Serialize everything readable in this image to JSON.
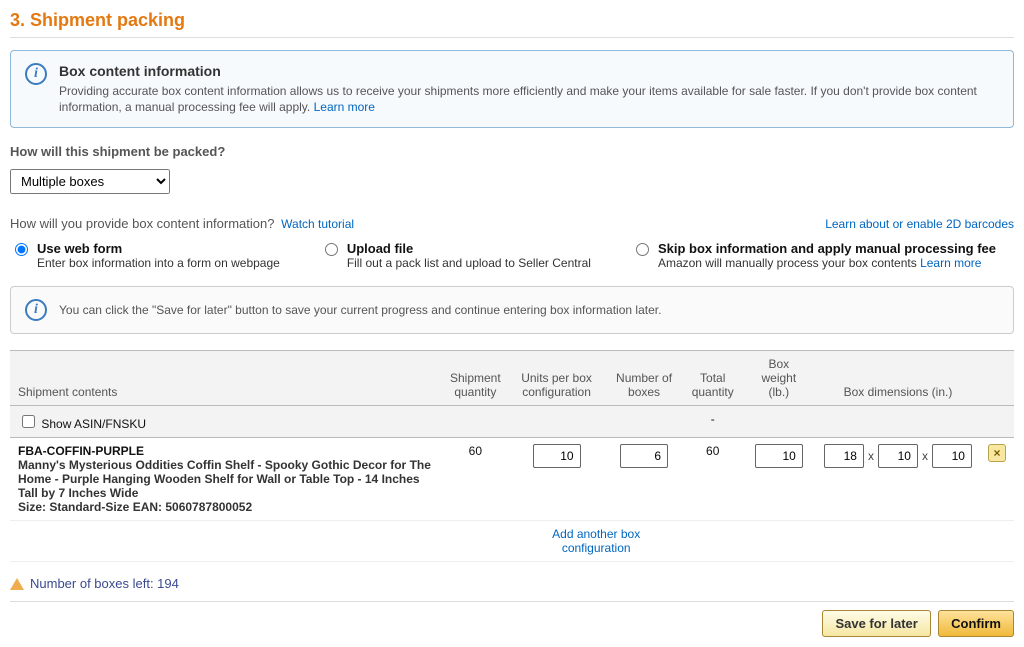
{
  "section_title": "3. Shipment packing",
  "info_alert": {
    "title": "Box content information",
    "body": "Providing accurate box content information allows us to receive your shipments more efficiently and make your items available for sale faster. If you don't provide box content information, a manual processing fee will apply.",
    "learn_more": "Learn more"
  },
  "pack_question": "How will this shipment be packed?",
  "pack_select_value": "Multiple boxes",
  "provide_question": "How will you provide box content information?",
  "watch_tutorial": "Watch tutorial",
  "enable_2d": "Learn about or enable 2D barcodes",
  "radios": {
    "web": {
      "label": "Use web form",
      "desc": "Enter box information into a form on webpage"
    },
    "upload": {
      "label": "Upload file",
      "desc": "Fill out a pack list and upload to Seller Central"
    },
    "skip": {
      "label": "Skip box information and apply manual processing fee",
      "desc_prefix": "Amazon will manually process your box contents ",
      "learn_more": "Learn more"
    }
  },
  "save_tip": "You can click the \"Save for later\" button to save your current progress and continue entering box information later.",
  "table": {
    "headers": {
      "contents": "Shipment contents",
      "ship_qty": "Shipment\nquantity",
      "units_per_box": "Units per box\nconfiguration",
      "num_boxes": "Number of\nboxes",
      "total_qty": "Total\nquantity",
      "box_weight": "Box weight\n(lb.)",
      "box_dims": "Box dimensions (in.)"
    },
    "show_asin_label": "Show ASIN/FNSKU",
    "center_dash": "-",
    "row": {
      "sku": "FBA-COFFIN-PURPLE",
      "desc": "Manny's Mysterious Oddities Coffin Shelf - Spooky Gothic Decor for The Home - Purple Hanging Wooden Shelf for Wall or Table Top - 14 Inches Tall by 7 Inches Wide",
      "size_line": "Size: Standard-Size EAN: 5060787800052",
      "ship_qty": "60",
      "units_per_box": "10",
      "num_boxes": "6",
      "total_qty": "60",
      "box_weight": "10",
      "dim_l": "18",
      "dim_w": "10",
      "dim_h": "10"
    },
    "add_config": "Add another box configuration"
  },
  "boxes_left": "Number of boxes left: 194",
  "buttons": {
    "save": "Save for later",
    "confirm": "Confirm"
  }
}
